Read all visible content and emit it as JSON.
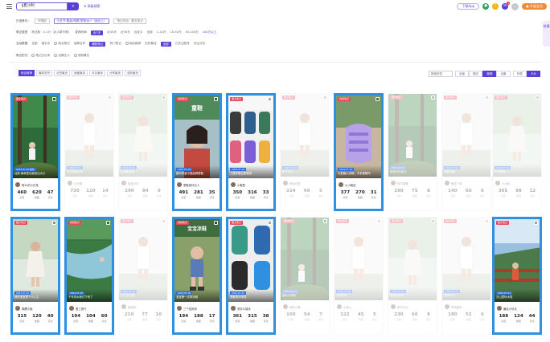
{
  "header": {
    "search_value": "ǁ夏沙制",
    "search_button": "⌕",
    "advanced_search": "⊕ 高级搜索",
    "download_btn": "下载App",
    "notif_count": "1",
    "upgrade_btn": "● 升级会员"
  },
  "side_panel": "快捷",
  "filters": {
    "row1": {
      "label": "已选条件：",
      "chips": [
        "不限制",
        "小红书·服装/母婴/宠物/女+（适合上）",
        "笔记形态：图文笔记"
      ]
    },
    "row2": {
      "items": [
        "笔记类型",
        "粉丝数：0-1万（泛人群不限）",
        "发布时间",
        "近7天",
        "近30天",
        "近90天",
        "自定义",
        "全部",
        "1-10万",
        "10-50万",
        "50-100万",
        "100万以上"
      ]
    },
    "row3": {
      "items": [
        "互动数据",
        "全部",
        "增长中",
        "商业笔记",
        "品牌合作",
        "爆款笔记",
        "热门笔记",
        "相似推荐",
        "历史最佳",
        "全部",
        "已关注账号",
        "对比分析"
      ]
    },
    "row4": {
      "items": [
        "笔记形式",
        "笔记日记本",
        "品牌达人",
        "低粉爆文"
      ]
    }
  },
  "tabs": [
    "综合推荐",
    "最新发布",
    "点赞最多",
    "收藏最多",
    "评论最多",
    "分享最多",
    "涨粉最多"
  ],
  "controls": {
    "sort": "按相关性",
    "views": [
      "全部",
      "图文",
      "视频",
      "合集"
    ],
    "seg2": [
      "列表",
      "卡片"
    ]
  },
  "stat_keys": [
    "点赞",
    "收藏",
    "评论"
  ],
  "cards_row1": [
    {
      "tag": "图文笔记",
      "blue": "2024.07.26 发布",
      "caption": "仙侠·森林里也能拍出大片",
      "author": "阿Yu的小日常",
      "likes": "460",
      "collects": "620",
      "comments": "47",
      "scene": "forest",
      "highlighted": true
    },
    {
      "tag": "图文笔记",
      "blue": "2024.07.11",
      "caption": "夏日穿搭分享",
      "author": "小可爱",
      "likes": "730",
      "collects": "120",
      "comments": "14",
      "scene": "girl",
      "highlighted": false
    },
    {
      "tag": "图文笔记",
      "blue": "2024.07.02",
      "caption": "小清新出游",
      "author": "宝宝日记",
      "likes": "290",
      "collects": "84",
      "comments": "9",
      "scene": "girl2",
      "highlighted": false
    },
    {
      "tag": "视频笔记",
      "blue": "2024.07.19",
      "caption": "超大体量中国品牌童鞋",
      "author": "童鞋测评达人",
      "likes": "491",
      "collects": "281",
      "comments": "35",
      "scene": "woman",
      "highlighted": true
    },
    {
      "tag": "图文笔记",
      "blue": "2024.07.16",
      "caption": "儿童凉鞋合集推荐",
      "author": "小鞋匠",
      "likes": "350",
      "collects": "316",
      "comments": "33",
      "scene": "shoes",
      "highlighted": true
    },
    {
      "tag": "图文笔记",
      "blue": "2024.07.08",
      "caption": "亲子出行",
      "author": "妈妈日常",
      "likes": "214",
      "collects": "69",
      "comments": "5",
      "scene": "girl",
      "highlighted": false
    },
    {
      "tag": "视频笔记",
      "blue": "2024.07.24",
      "caption": "今夏最火凉鞋，不来看看吗",
      "author": "小小鞋店",
      "likes": "377",
      "collects": "270",
      "comments": "31",
      "scene": "sandal",
      "highlighted": true
    },
    {
      "tag": "图文笔记",
      "blue": "2024.07.12",
      "caption": "男孩子的夏天",
      "author": "阿牛爸爸",
      "likes": "190",
      "collects": "75",
      "comments": "8",
      "scene": "forest",
      "highlighted": false
    },
    {
      "tag": "图文笔记",
      "blue": "2024.07.05",
      "caption": "凉鞋开箱",
      "author": "鞋控一枚",
      "likes": "140",
      "collects": "60",
      "comments": "6",
      "scene": "girl",
      "highlighted": false
    },
    {
      "tag": "图文笔记",
      "blue": "2024.07.03",
      "caption": "户外穿搭",
      "author": "小太阳",
      "likes": "305",
      "collects": "98",
      "comments": "12",
      "scene": "girl2",
      "highlighted": false
    }
  ],
  "cards_row2": [
    {
      "tag": "图文笔记",
      "blue": "2024.07.22",
      "caption": "我的宝宝是个小公主",
      "author": "锦鲤小姐",
      "likes": "315",
      "collects": "120",
      "comments": "40",
      "scene": "girl2",
      "highlighted": true
    },
    {
      "tag": "视频笔记",
      "blue": "2024.07.20",
      "caption": "千年的水我们下来了",
      "author": "爱上旅行",
      "likes": "194",
      "collects": "104",
      "comments": "60",
      "scene": "stream",
      "highlighted": true
    },
    {
      "tag": "图文笔记",
      "blue": "2024.07.14",
      "caption": "小公主出街",
      "author": "甜甜妈",
      "likes": "210",
      "collects": "77",
      "comments": "10",
      "scene": "girl",
      "highlighted": false
    },
    {
      "tag": "视频笔记",
      "blue": "2024.07.18",
      "caption": "宝宝第一次穿凉鞋",
      "author": "三个娃妈妈",
      "likes": "194",
      "collects": "188",
      "comments": "17",
      "scene": "toddler",
      "highlighted": true
    },
    {
      "tag": "图文笔记",
      "blue": "2024.07.15",
      "caption": "童鞋测评来啦",
      "author": "测评小能手",
      "likes": "361",
      "collects": "315",
      "comments": "38",
      "scene": "shoes2",
      "highlighted": true
    },
    {
      "tag": "图文笔记",
      "blue": "2024.07.10",
      "caption": "森系小清新",
      "author": "林间小鹿",
      "likes": "160",
      "collects": "54",
      "comments": "7",
      "scene": "forest",
      "highlighted": false
    },
    {
      "tag": "图文笔记",
      "blue": "2024.07.09",
      "caption": "海边穿搭",
      "author": "小鱼儿",
      "likes": "122",
      "collects": "45",
      "comments": "5",
      "scene": "girl",
      "highlighted": false
    },
    {
      "tag": "图文笔记",
      "blue": "2024.07.06",
      "caption": "周末出游记",
      "author": "旅行日记",
      "likes": "230",
      "collects": "66",
      "comments": "9",
      "scene": "girl2",
      "highlighted": false
    },
    {
      "tag": "图文笔记",
      "blue": "2024.07.04",
      "caption": "穿搭分享",
      "author": "时尚宝妈",
      "likes": "180",
      "collects": "52",
      "comments": "6",
      "scene": "girl",
      "highlighted": false
    },
    {
      "tag": "图文笔记",
      "blue": "2024.07.21",
      "caption": "去山里玩水啦",
      "author": "暴走小队长",
      "likes": "188",
      "collects": "124",
      "comments": "44",
      "scene": "bridge",
      "highlighted": true
    }
  ]
}
